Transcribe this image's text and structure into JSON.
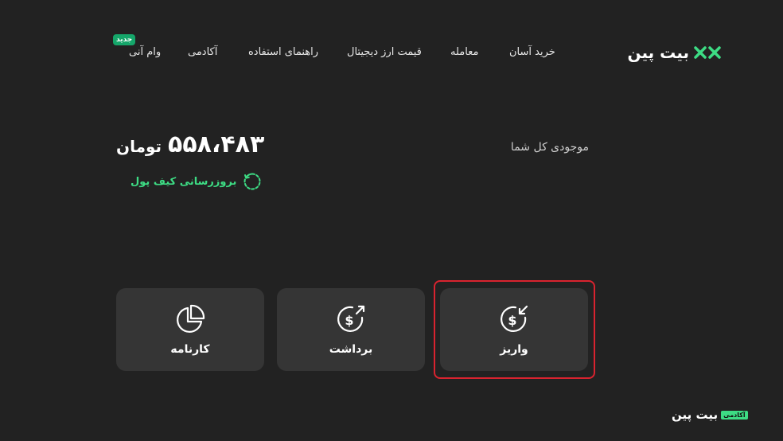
{
  "nav": {
    "items": [
      {
        "label": "خرید آسان"
      },
      {
        "label": "معامله"
      },
      {
        "label": "قیمت ارز دیجیتال"
      },
      {
        "label": "راهنمای استفاده"
      },
      {
        "label": "آکادمی"
      },
      {
        "label": "وام آنی"
      }
    ],
    "new_badge": "جدید",
    "logo_text": "بیت پین"
  },
  "balance": {
    "label": "موجودی کل شما",
    "amount": "۵۵۸،۴۸۳",
    "unit": "تومان",
    "refresh_label": "بروزرسانی کیف پول"
  },
  "actions": [
    {
      "label": "واریز",
      "icon": "deposit-icon",
      "highlighted": true
    },
    {
      "label": "برداشت",
      "icon": "withdraw-icon"
    },
    {
      "label": "کارنامه",
      "icon": "report-chart-icon"
    }
  ],
  "footer": {
    "academy_tag": "آکادمی",
    "logo_text": "بیت پین"
  },
  "colors": {
    "background": "#222222",
    "card": "#353535",
    "accent_green": "#3ddc84",
    "highlight_red": "#d9232f"
  }
}
